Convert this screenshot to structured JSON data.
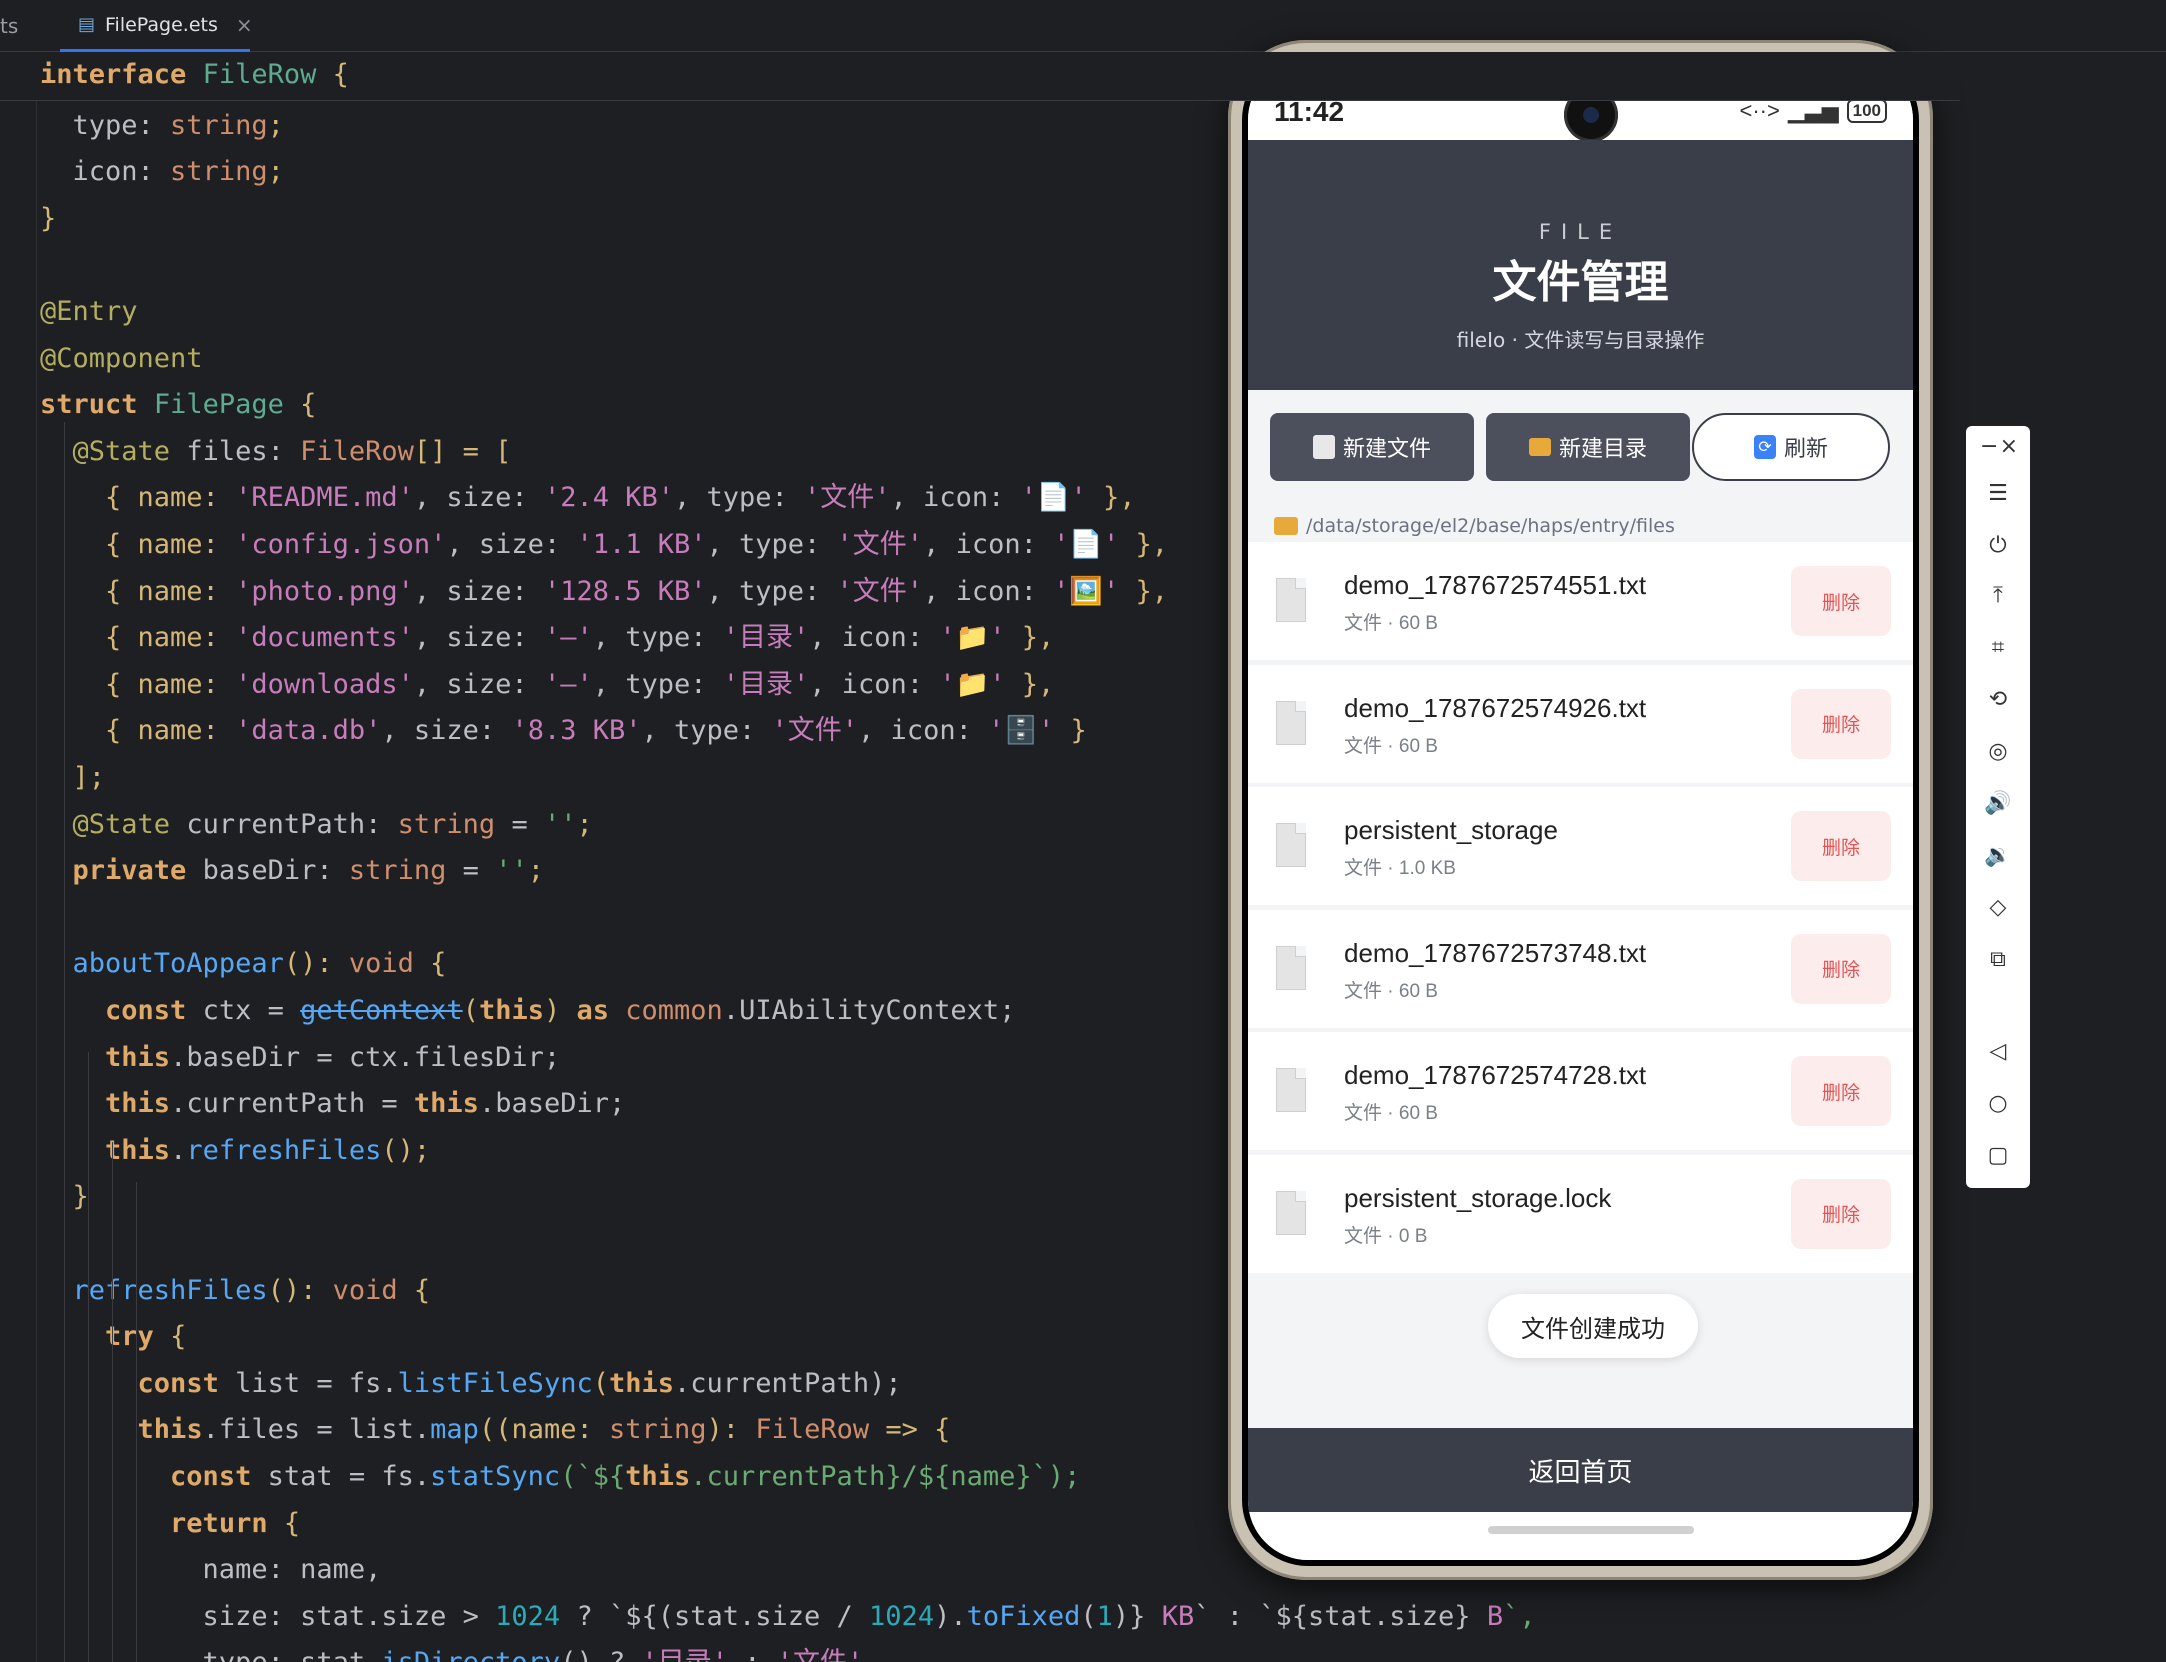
{
  "editor": {
    "tab_edge": "ts",
    "tab": {
      "label": "FilePage.ets",
      "close": "×"
    },
    "code": {
      "l0": [
        "interface",
        " ",
        "FileRow",
        " {"
      ],
      "l1": [
        "  type: ",
        "string",
        ";"
      ],
      "l2": [
        "  icon: ",
        "string",
        ";"
      ],
      "l3": [
        "}"
      ],
      "l5": [
        "@Entry"
      ],
      "l6": [
        "@Component"
      ],
      "l7": [
        "struct",
        " ",
        "FilePage",
        " {"
      ],
      "l8": [
        "  ",
        "@State",
        " files: ",
        "FileRow",
        "[] = ["
      ],
      "rows": [
        {
          "name": "'README.md'",
          "size": "'2.4 KB'",
          "type": "'文件'",
          "icon": "'📄'",
          "pad": "  "
        },
        {
          "name": "'config.json'",
          "size": "'1.1 KB'",
          "type": "'文件'",
          "icon": "'📄'",
          "pad": "  "
        },
        {
          "name": "'photo.png'",
          "size": "'128.5 KB'",
          "type": "'文件'",
          "icon": "'🖼️'",
          "pad": "  "
        },
        {
          "name": "'documents'",
          "size": "'—'",
          "type": "'目录'",
          "icon": "'📁'",
          "pad": "  "
        },
        {
          "name": "'downloads'",
          "size": "'—'",
          "type": "'目录'",
          "icon": "'📁'",
          "pad": "  "
        },
        {
          "name": "'data.db'",
          "size": "'8.3 KB'",
          "type": "'文件'",
          "icon": "'🗄️'",
          "pad": "  "
        }
      ],
      "row_tokens": {
        "open": "    { name: ",
        "size": ", size: ",
        "type": ", type: ",
        "icon": ", icon: ",
        "close": " },",
        "close_last": " }"
      },
      "l15": [
        "  ];"
      ],
      "l16": [
        "  ",
        "@State",
        " currentPath: ",
        "string",
        " = ",
        "''",
        ";"
      ],
      "l17": [
        "  ",
        "private",
        " baseDir: ",
        "string",
        " = ",
        "''",
        ";"
      ],
      "l19": [
        "  ",
        "aboutToAppear",
        "(): ",
        "void",
        " {"
      ],
      "l20": [
        "    ",
        "const",
        " ctx = ",
        "getContext",
        "(",
        "this",
        ") ",
        "as",
        " ",
        "common",
        ".UIAbilityContext;"
      ],
      "l21": [
        "    ",
        "this",
        ".baseDir = ctx.filesDir;"
      ],
      "l22": [
        "    ",
        "this",
        ".currentPath = ",
        "this",
        ".baseDir;"
      ],
      "l23": [
        "    ",
        "this",
        ".",
        "refreshFiles",
        "();"
      ],
      "l24": [
        "  }"
      ],
      "l26": [
        "  ",
        "refreshFiles",
        "(): ",
        "void",
        " {"
      ],
      "l27": [
        "    ",
        "try",
        " {"
      ],
      "l28": [
        "      ",
        "const",
        " list = fs.",
        "listFileSync",
        "(",
        "this",
        ".currentPath);"
      ],
      "l29": [
        "      ",
        "this",
        ".files = list.",
        "map",
        "((name: ",
        "string",
        "): ",
        "FileRow",
        " => {"
      ],
      "l30": [
        "        ",
        "const",
        " stat = fs.",
        "statSync",
        "(`${",
        "this",
        ".currentPath}/${name}`);"
      ],
      "l31": [
        "        ",
        "return",
        " {"
      ],
      "l32": [
        "          name: name,"
      ],
      "l33": [
        "          size: stat.size > ",
        "1024",
        " ? `${(stat.size / ",
        "1024",
        ").",
        "toFixed",
        "(",
        "1",
        ")} ",
        "KB",
        "` : `${stat.size} ",
        "B",
        "`,"
      ],
      "l34": [
        "          type: stat.",
        "isDirectory",
        "() ? ",
        "'目录'",
        " : ",
        "'文件'",
        ","
      ]
    }
  },
  "phone": {
    "status": {
      "time": "11:42",
      "signal": "<··>",
      "battery": "100"
    },
    "header": {
      "eyebrow": "FILE",
      "title": "文件管理",
      "subtitle": "fileIo · 文件读写与目录操作"
    },
    "actions": [
      {
        "label": "新建文件",
        "icon": "file-icon"
      },
      {
        "label": "新建目录",
        "icon": "folder-icon"
      },
      {
        "label": "刷新",
        "icon": "refresh-icon"
      }
    ],
    "path": "/data/storage/el2/base/haps/entry/files",
    "files": [
      {
        "name": "demo_1787672574551.txt",
        "meta": "文件 · 60 B",
        "delete": "删除"
      },
      {
        "name": "demo_1787672574926.txt",
        "meta": "文件 · 60 B",
        "delete": "删除"
      },
      {
        "name": "persistent_storage",
        "meta": "文件 · 1.0 KB",
        "delete": "删除"
      },
      {
        "name": "demo_1787672573748.txt",
        "meta": "文件 · 60 B",
        "delete": "删除"
      },
      {
        "name": "demo_1787672574728.txt",
        "meta": "文件 · 60 B",
        "delete": "删除"
      },
      {
        "name": "persistent_storage.lock",
        "meta": "文件 · 0 B",
        "delete": "删除"
      }
    ],
    "toast": "文件创建成功",
    "back": "返回首页"
  },
  "toolbar": {
    "minimize": "−",
    "close": "×",
    "buttons": [
      "menu-icon",
      "power-icon",
      "pin-top-icon",
      "crop-icon",
      "rotate-icon",
      "location-icon",
      "volume-up-icon",
      "volume-down-icon",
      "shake-icon",
      "screenshot-icon",
      "back-nav-icon",
      "home-nav-icon",
      "recent-apps-icon"
    ],
    "glyphs": [
      "☰",
      "⏻",
      "⤒",
      "⌗",
      "⟲",
      "◎",
      "🔊",
      "🔉",
      "◇",
      "⧉",
      "◁",
      "○",
      "▢"
    ]
  }
}
